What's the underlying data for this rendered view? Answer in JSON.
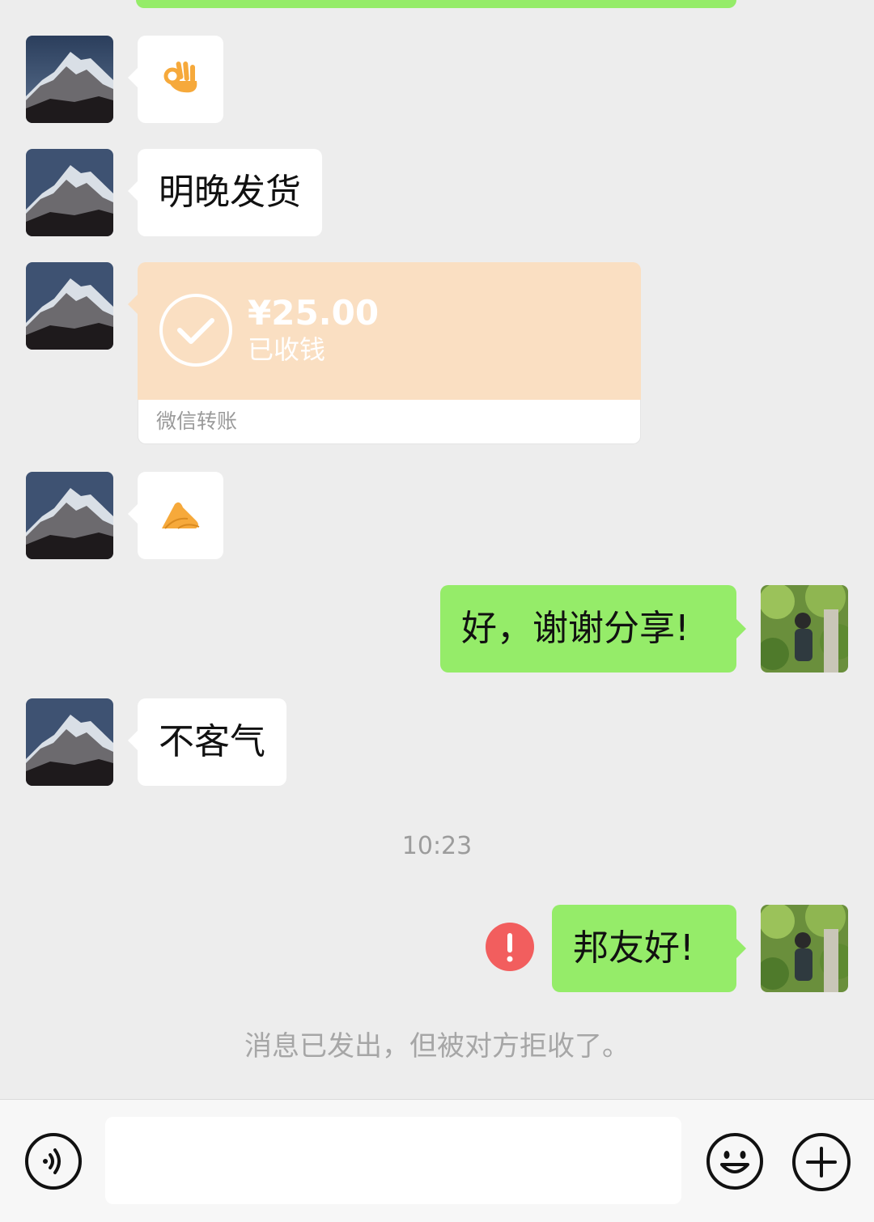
{
  "messages": {
    "m1_emoji": "ok-hand",
    "m2_text": "明晚发货",
    "transfer": {
      "amount": "¥25.00",
      "status": "已收钱",
      "label": "微信转账"
    },
    "m4_emoji": "pinched-hand",
    "m5_text": "好，谢谢分享!",
    "m6_text": "不客气",
    "time": "10:23",
    "m7_text": "邦友好!",
    "system_note": "消息已发出，但被对方拒收了。"
  },
  "colors": {
    "background": "#EDEDED",
    "outgoing_bubble": "#95EC69",
    "incoming_bubble": "#FFFFFF",
    "transfer_card": "#FADFC2",
    "error_red": "#F25E5E"
  },
  "input_bar": {
    "text_value": ""
  }
}
